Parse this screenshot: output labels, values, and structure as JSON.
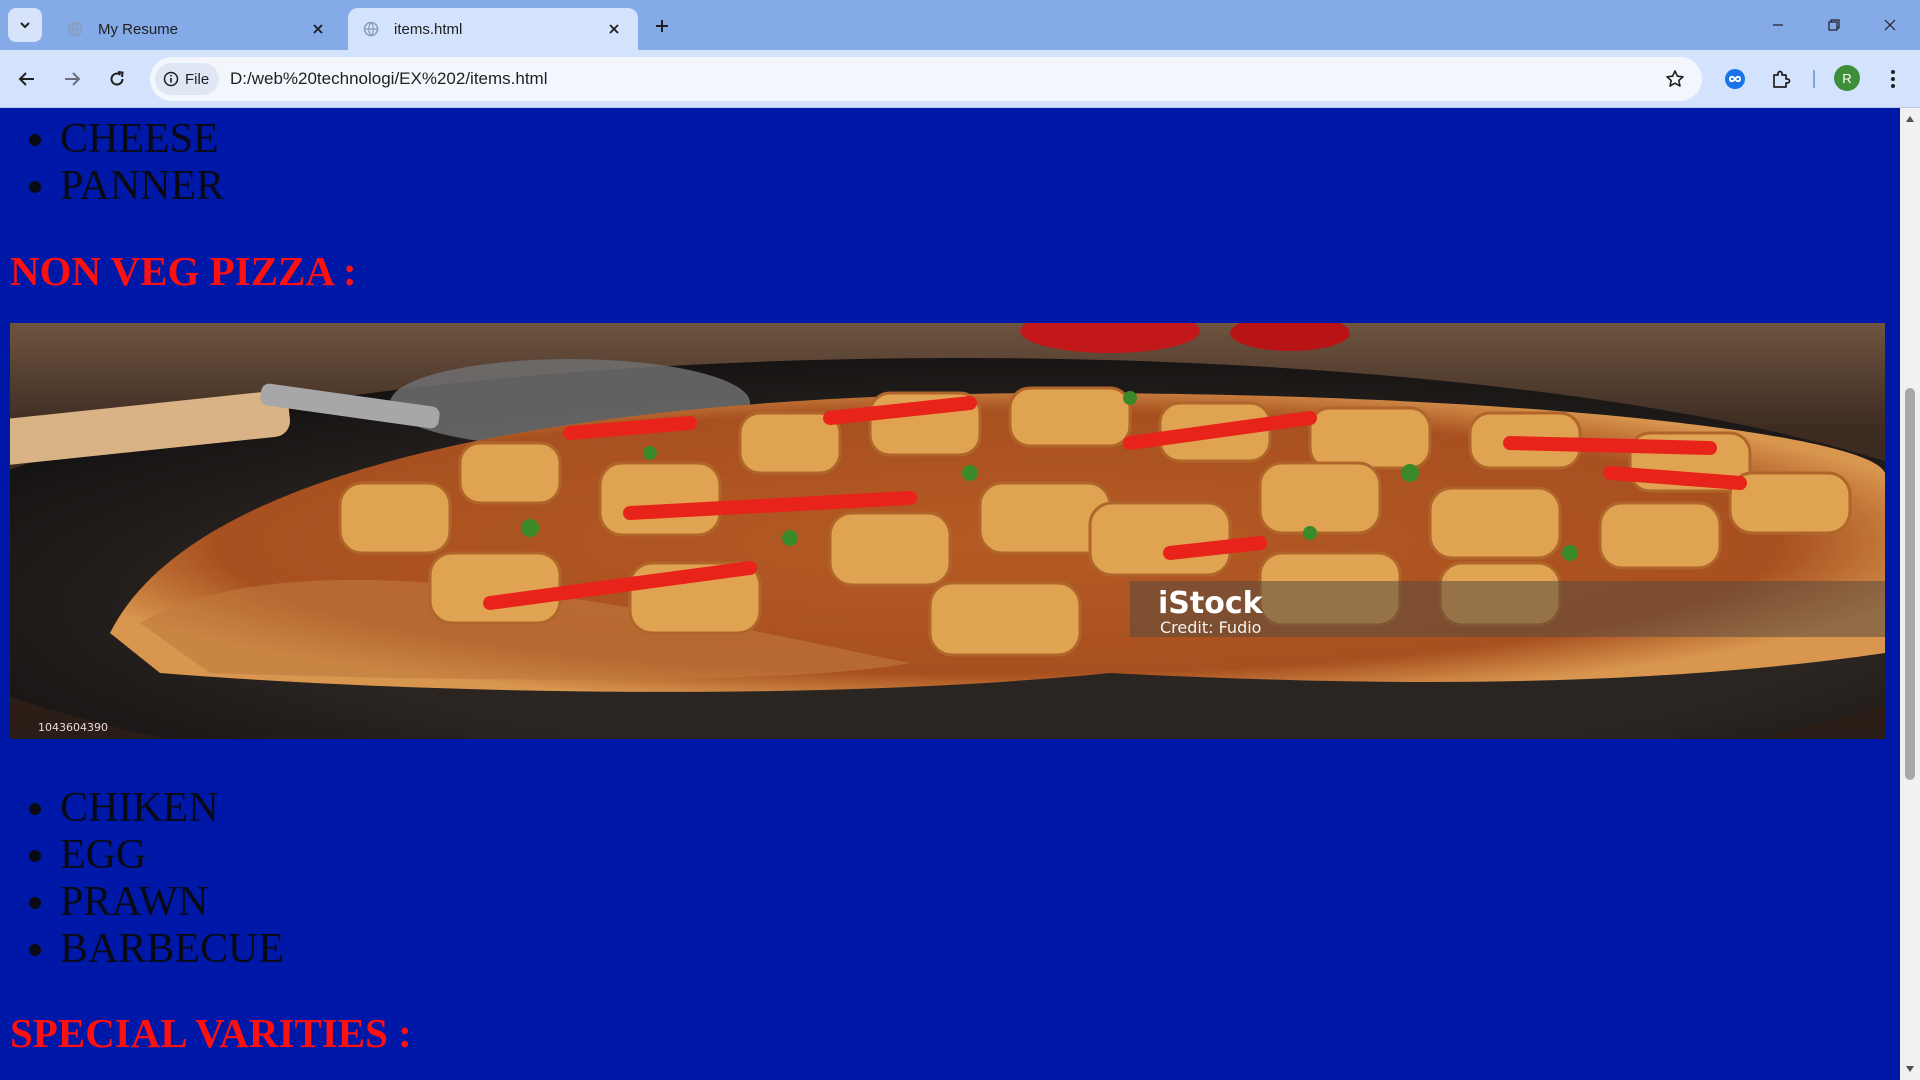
{
  "browser": {
    "tabs": [
      {
        "title": "My Resume",
        "active": false
      },
      {
        "title": "items.html",
        "active": true
      }
    ],
    "site_chip_label": "File",
    "url": "D:/web%20technologi/EX%202/items.html",
    "profile_initial": "R"
  },
  "page": {
    "veg_items_tail": [
      "CHEESE",
      "PANNER"
    ],
    "nonveg_heading": "NON VEG PIZZA :",
    "nonveg_image": {
      "watermark_brand": "iStock",
      "watermark_credit": "Credit: Fudio",
      "stock_id": "1043604390"
    },
    "nonveg_items": [
      "CHIKEN",
      "EGG",
      "PRAWN",
      "BARBECUE"
    ],
    "special_heading": "SPECIAL VARITIES :"
  },
  "colors": {
    "page_background": "#0018a8",
    "heading": "#ff1010",
    "list_text": "#0a0a14",
    "tabstrip": "#84abe8",
    "toolbar": "#d3e3fd"
  }
}
